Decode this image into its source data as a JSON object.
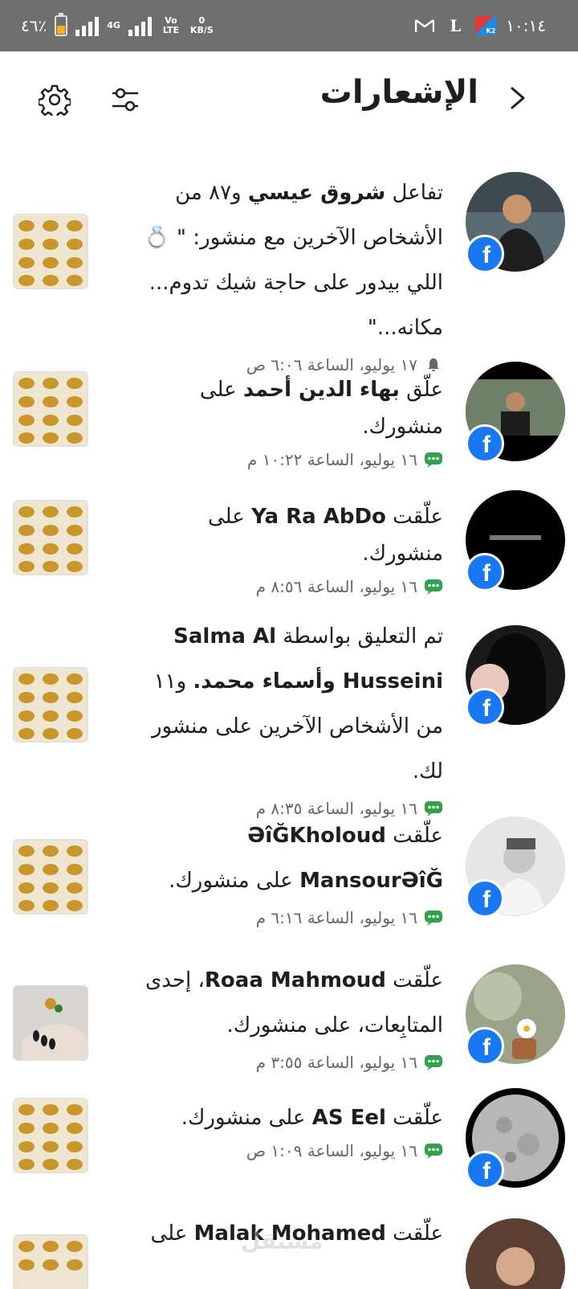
{
  "status_bar": {
    "battery": "٤٦٪",
    "battery_level": 0.46,
    "network": "4G",
    "volte": "Vo LTE",
    "speed_value": "0",
    "speed_unit": "KB/S",
    "app_icons": [
      "gmail-icon",
      "l-app-icon",
      "news-app-icon"
    ],
    "time": "١٠:١٤"
  },
  "header": {
    "title": "الإشعارات"
  },
  "notifications": [
    {
      "prefix": "تفاعل ",
      "name": "شروق عيسي",
      "suffix": " و٨٧ من الأشخاص الآخرين مع منشور: \" 💍 اللي بيدور على حاجة شيك تدوم... مكانه...\"",
      "time": "١٧ يوليو، الساعة ٦:٠٦ ص",
      "meta_icon": "bell-icon",
      "avatar_color": "#5b4a3c"
    },
    {
      "prefix": "علّق ",
      "name": "بهاء الدين أحمد",
      "suffix": " على منشورك.",
      "time": "١٦ يوليو، الساعة ١٠:٢٢ م",
      "meta_icon": "comment-icon",
      "avatar_color": "#3d4b3c"
    },
    {
      "prefix": "علّقت ",
      "name": "Ya Ra AbDo",
      "suffix": " على منشورك.",
      "time": "١٦ يوليو، الساعة ٨:٥٦ م",
      "meta_icon": "comment-icon",
      "avatar_color": "#000000"
    },
    {
      "prefix": "تم التعليق بواسطة ",
      "name": "Salma Al Husseini",
      "mid": " وأسماء محمد.",
      "suffix": " و١١ من الأشخاص الآخرين على منشور لك.",
      "time": "١٦ يوليو، الساعة ٨:٣٥ م",
      "meta_icon": "comment-icon",
      "avatar_color": "#2a2a2a"
    },
    {
      "prefix": "علّقت ",
      "name": "ƏîĞKholoud MansourƏîĞ",
      "suffix": " على منشورك.",
      "time": "١٦ يوليو، الساعة ٦:١٦ م",
      "meta_icon": "comment-icon",
      "avatar_color": "#d9d9d9"
    },
    {
      "prefix": "علّقت ",
      "name": "Roaa Mahmoud",
      "suffix": "، إحدى المتابِعات، على منشورك.",
      "time": "١٦ يوليو، الساعة ٣:٥٥ م",
      "meta_icon": "comment-icon",
      "avatar_color": "#8a9a7a"
    },
    {
      "prefix": "علّقت ",
      "name": "AS Eel",
      "suffix": " على منشورك.",
      "time": "١٦ يوليو، الساعة ١:٠٩ ص",
      "meta_icon": "comment-icon",
      "avatar_color": "#9a9a9a"
    },
    {
      "prefix": "علّقت ",
      "name": "Malak Mohamed",
      "suffix": " على",
      "time": "",
      "meta_icon": "",
      "avatar_color": "#6b4a3a"
    }
  ],
  "watermark": "مستقل",
  "colors": {
    "facebook_blue": "#1877f2",
    "comment_green": "#31a24c",
    "meta_gray": "#65676b",
    "status_bar": "#6f6f6f"
  }
}
